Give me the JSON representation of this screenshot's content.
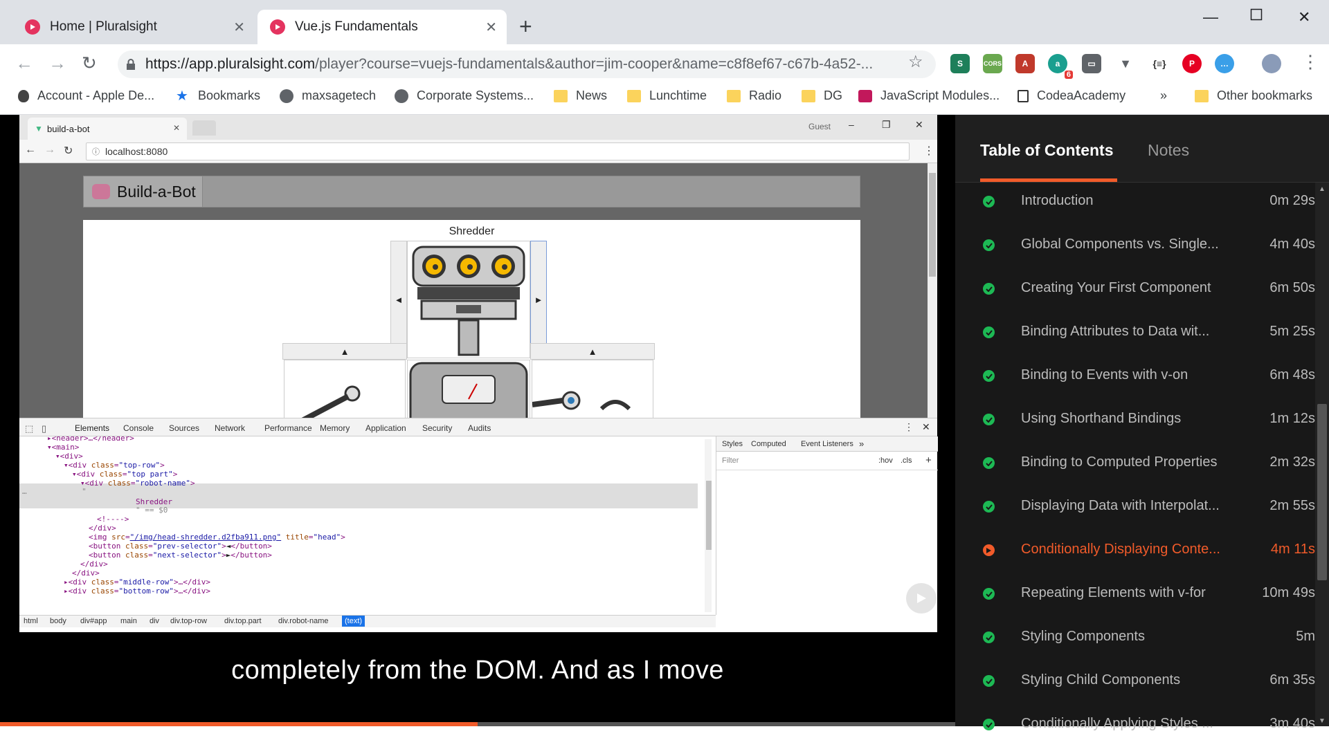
{
  "browser": {
    "tabs": [
      {
        "title": "Home | Pluralsight",
        "active": false
      },
      {
        "title": "Vue.js Fundamentals",
        "active": true
      }
    ],
    "url_host": "https://app.pluralsight.com",
    "url_path": "/player?course=vuejs-fundamentals&author=jim-cooper&name=c8f8ef67-c67b-4a52-...",
    "extension_badge": "6",
    "bookmarks": [
      {
        "label": "Account - Apple De...",
        "icon": "apple-icon"
      },
      {
        "label": "Bookmarks",
        "icon": "star-icon"
      },
      {
        "label": "maxsagetech",
        "icon": "globe-icon"
      },
      {
        "label": "Corporate Systems...",
        "icon": "globe-icon"
      },
      {
        "label": "News",
        "icon": "folder-icon"
      },
      {
        "label": "Lunchtime",
        "icon": "folder-icon"
      },
      {
        "label": "Radio",
        "icon": "folder-icon"
      },
      {
        "label": "DG",
        "icon": "folder-icon"
      },
      {
        "label": "JavaScript Modules...",
        "icon": "site-icon"
      },
      {
        "label": "CodeaAcademy",
        "icon": "site-icon"
      }
    ],
    "bookmarks_overflow": "»",
    "other_bookmarks": "Other bookmarks"
  },
  "video": {
    "inner_tab_title": "build-a-bot",
    "inner_profile": "Guest",
    "inner_url": "localhost:8080",
    "app_brand": "Build-a-Bot",
    "robot_name": "Shredder",
    "devtools_tabs": [
      "Elements",
      "Console",
      "Sources",
      "Network",
      "Performance",
      "Memory",
      "Application",
      "Security",
      "Audits"
    ],
    "styles_tabs": [
      "Styles",
      "Computed",
      "Event Listeners",
      "»"
    ],
    "styles_filter": "Filter",
    "styles_hov": ":hov",
    "styles_cls": ".cls",
    "breadcrumbs": [
      "html",
      "body",
      "div#app",
      "main",
      "div",
      "div.top-row",
      "div.top.part",
      "div.robot-name",
      "(text)"
    ],
    "subtitle": "completely from the DOM. And as I move",
    "progress_fraction": 0.5
  },
  "sidebar": {
    "tabs": [
      "Table of Contents",
      "Notes"
    ],
    "items": [
      {
        "title": "Introduction",
        "duration": "0m 29s",
        "status": "done"
      },
      {
        "title": "Global Components vs. Single...",
        "duration": "4m 40s",
        "status": "done"
      },
      {
        "title": "Creating Your First Component",
        "duration": "6m 50s",
        "status": "done"
      },
      {
        "title": "Binding Attributes to Data wit...",
        "duration": "5m 25s",
        "status": "done"
      },
      {
        "title": "Binding to Events with v-on",
        "duration": "6m 48s",
        "status": "done"
      },
      {
        "title": "Using Shorthand Bindings",
        "duration": "1m 12s",
        "status": "done"
      },
      {
        "title": "Binding to Computed Properties",
        "duration": "2m 32s",
        "status": "done"
      },
      {
        "title": "Displaying Data with Interpolat...",
        "duration": "2m 55s",
        "status": "done"
      },
      {
        "title": "Conditionally Displaying Conte...",
        "duration": "4m 11s",
        "status": "current"
      },
      {
        "title": "Repeating Elements with v-for",
        "duration": "10m 49s",
        "status": "done"
      },
      {
        "title": "Styling Components",
        "duration": "5m",
        "status": "done"
      },
      {
        "title": "Styling Child Components",
        "duration": "6m 35s",
        "status": "done"
      },
      {
        "title": "Conditionally Applying Styles ...",
        "duration": "3m 40s",
        "status": "done"
      }
    ]
  }
}
